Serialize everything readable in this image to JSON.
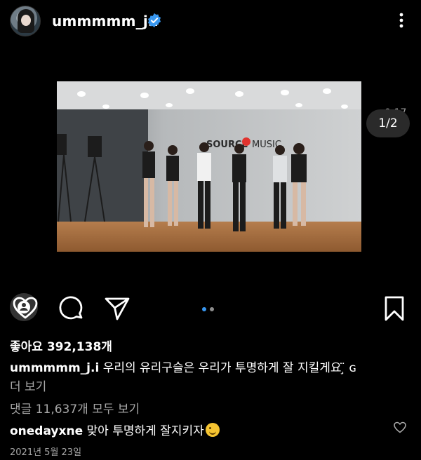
{
  "post": {
    "username": "ummmmm_j.i",
    "verified": true,
    "avatar_icon": "avatar-icon"
  },
  "media": {
    "counter": "1/2",
    "video_time": "0:17",
    "video_sign_brand": "SOURCE",
    "video_sign_rest": "MUSIC"
  },
  "carousel": {
    "total": 2,
    "active": 1,
    "active_color": "#3897f0",
    "inactive_color": "#8e8e8e"
  },
  "likes": {
    "label": "좋아요 392,138개"
  },
  "caption": {
    "author": "ummmmm_j.i",
    "text": " 우리의 유리구슬은 우리가 투명하게 잘 지킬게요 ̧̈ ɢ",
    "more": "더 보기"
  },
  "comments": {
    "view_all": "댓글 11,637개 모두 보기",
    "top_comment": {
      "author": "onedayxne",
      "text": " 맞아 투명하게 잘지키자"
    }
  },
  "date": "2021년 5월 23일"
}
